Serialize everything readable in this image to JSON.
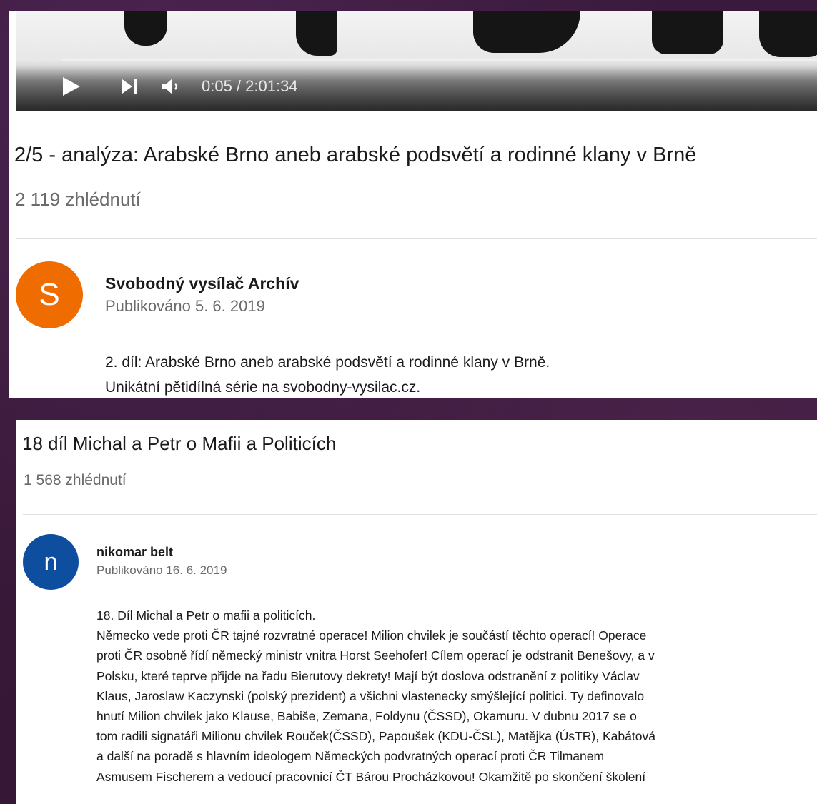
{
  "video1": {
    "player": {
      "time_display": "0:05 / 2:01:34",
      "progress_fraction": 0.0007
    },
    "title": "2/5 - analýza: Arabské Brno aneb arabské podsvětí a rodinné klany v Brně",
    "views": "2 119 zhlédnutí",
    "channel": {
      "avatar_letter": "S",
      "avatar_color": "#ef6c00",
      "name": "Svobodný vysílač Archív",
      "published": "Publikováno 5. 6. 2019"
    },
    "description": [
      "2. díl: Arabské Brno aneb arabské podsvětí a rodinné klany v Brně.",
      "Unikátní pětidílná série na svobodny-vysilac.cz."
    ]
  },
  "video2": {
    "title": "18 díl Michal a Petr o Mafii a Politicích",
    "views": "1 568 zhlédnutí",
    "channel": {
      "avatar_letter": "n",
      "avatar_color": "#0d4f9e",
      "name": "nikomar belt",
      "published": "Publikováno 16. 6. 2019"
    },
    "description": [
      "18. Díl Michal a Petr o mafii a politicích.",
      "Německo vede proti ČR tajné rozvratné operace! Milion chvilek je součástí těchto operací! Operace",
      "proti ČR osobně řídí německý ministr vnitra Horst Seehofer! Cílem operací je odstranit Benešovy, a v",
      "Polsku, které teprve přijde na řadu Bierutovy dekrety! Mají být doslova odstranění z politiky Václav",
      "Klaus, Jaroslaw Kaczynski (polský prezident) a všichni vlastenecky smýšlející politici. Ty definovalo",
      "hnutí Milion chvilek jako Klause, Babiše, Zemana, Foldynu (ČSSD), Okamuru. V dubnu 2017 se o",
      "tom radili signatáři Milionu chvilek Rouček(ČSSD), Papoušek (KDU-ČSL), Matějka (ÚsTR), Kabátová",
      "a další na poradě s hlavním ideologem Německých podvratných operací proti ČR Tilmanem",
      "Asmusem Fischerem a vedoucí pracovnicí ČT Bárou Procházkovou! Okamžitě po skončení školení"
    ]
  }
}
